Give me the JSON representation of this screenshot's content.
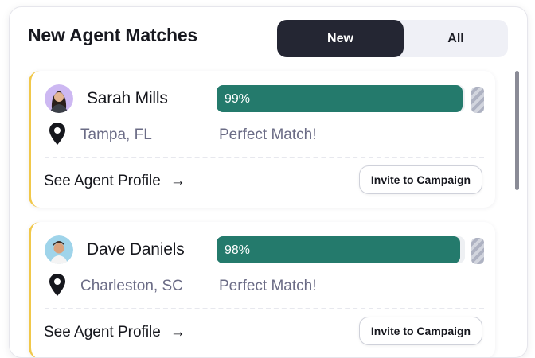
{
  "header": {
    "title": "New Agent Matches",
    "tabs": [
      {
        "label": "New",
        "selected": true
      },
      {
        "label": "All",
        "selected": false
      }
    ]
  },
  "colors": {
    "accent_bar": "#247a6c",
    "card_left_border": "#f1c84a",
    "toggle_active": "#242633"
  },
  "matches": [
    {
      "name": "Sarah Mills",
      "location": "Tampa, FL",
      "match_percent_label": "99%",
      "match_percent": 99,
      "match_text": "Perfect Match!",
      "profile_link": "See Agent Profile",
      "invite_label": "Invite to Campaign",
      "avatar": "woman-avatar"
    },
    {
      "name": "Dave Daniels",
      "location": "Charleston, SC",
      "match_percent_label": "98%",
      "match_percent": 98,
      "match_text": "Perfect Match!",
      "profile_link": "See Agent Profile",
      "invite_label": "Invite to Campaign",
      "avatar": "man-avatar"
    }
  ],
  "icons": {
    "location": "map-pin-icon",
    "profile_arrow": "arrow-right-icon"
  }
}
